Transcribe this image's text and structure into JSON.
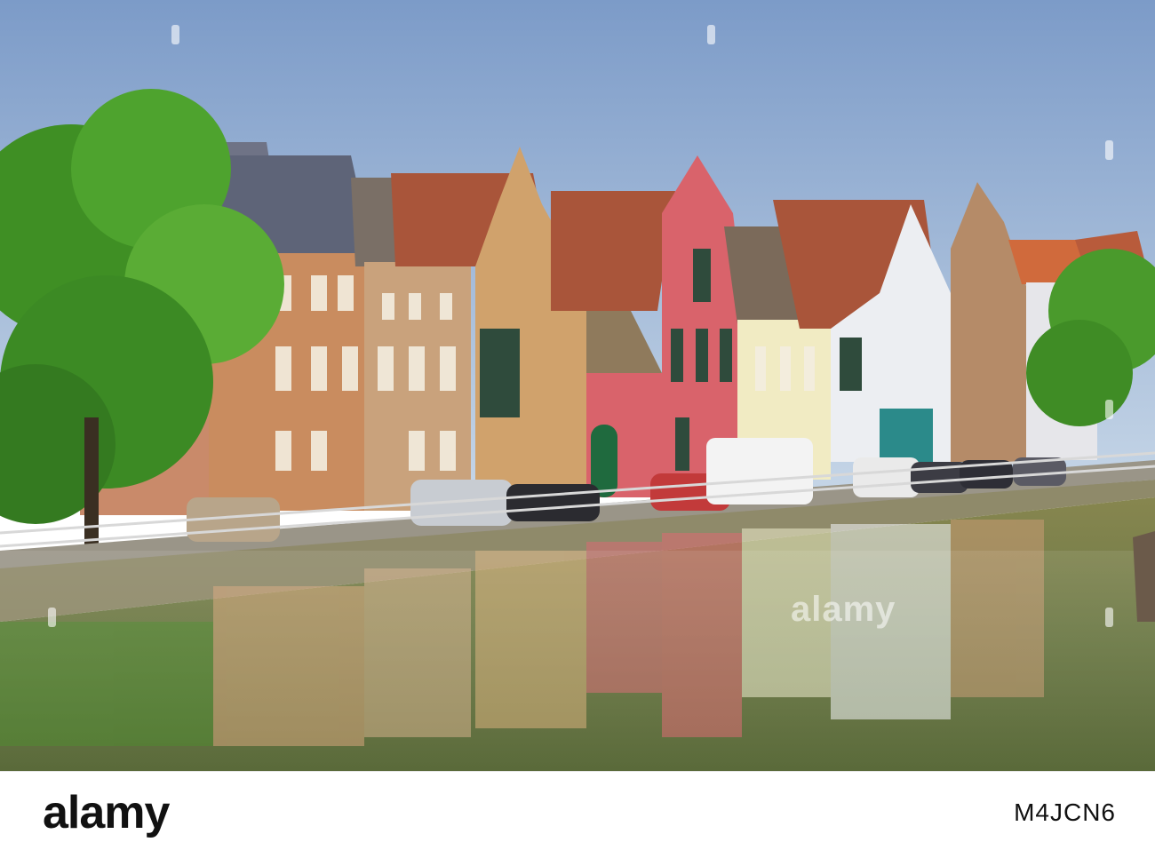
{
  "photo": {
    "subject": "canal-side gabled houses with reflections",
    "colors": {
      "sky_top": "#7c9bc8",
      "sky_bottom": "#c2d3e6",
      "water": "#6f7a4f",
      "tree": "#4c9a2a",
      "quay": "#8f8a6a",
      "roof": "#a9553a",
      "red_facade": "#d9636b"
    }
  },
  "watermark": {
    "center_text": "alamy",
    "icon": "alamy-tick-mark"
  },
  "footer": {
    "logo_text": "alamy",
    "image_id": "M4JCN6"
  }
}
